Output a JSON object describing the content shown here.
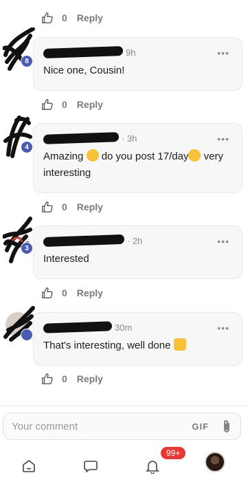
{
  "top_action": {
    "count": "0",
    "reply_label": "Reply"
  },
  "comments": [
    {
      "level": "8",
      "time": "9h",
      "text": "Nice one, Cousin!",
      "count": "0",
      "reply_label": "Reply",
      "more": "•••"
    },
    {
      "level": "4",
      "time": "· 3h",
      "text_before": "Amazing",
      "text_mid": "do you post 17/day",
      "text_after": "very interesting",
      "count": "0",
      "reply_label": "Reply",
      "more": "•••"
    },
    {
      "level": "3",
      "time": "· 2h",
      "text": "Interested",
      "count": "0",
      "reply_label": "Reply",
      "more": "•••"
    },
    {
      "level": "",
      "time": "30m",
      "text": "That's interesting, well done",
      "count": "0",
      "reply_label": "Reply",
      "more": "•••"
    }
  ],
  "composer": {
    "placeholder": "Your comment",
    "gif_label": "GIF"
  },
  "nav": {
    "notifications_badge": "99+"
  },
  "colors": {
    "badge_blue": "#4a5bb5",
    "notif_red": "#e53935",
    "bubble_bg": "#f7f7f7"
  }
}
